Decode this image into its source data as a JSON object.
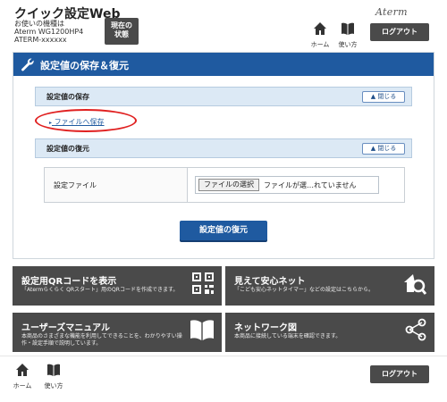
{
  "header": {
    "app_title": "クイック設定Web",
    "model_label": "お使いの機種は",
    "model_name": "Aterm WG1200HP4",
    "model_id": "ATERM-xxxxxx",
    "status_button_line1": "現在の",
    "status_button_line2": "状態",
    "home_label": "ホーム",
    "help_label": "使い方",
    "brand_logo": "Aterm",
    "logout_label": "ログアウト"
  },
  "main": {
    "title": "設定値の保存＆復元",
    "save_section": {
      "title": "設定値の保存",
      "close_label": "閉じる",
      "link_label": "ファイルへ保存"
    },
    "restore_section": {
      "title": "設定値の復元",
      "close_label": "閉じる",
      "file_label": "設定ファイル",
      "choose_button_label": "ファイルの選択",
      "file_status": "ファイルが選…れていません"
    },
    "restore_button_label": "設定値の復元"
  },
  "tiles": [
    {
      "title": "設定用QRコードを表示",
      "desc": "「Atermらくらく QRスタート」用のQRコードを作成できます。",
      "icon": "qr-code-icon"
    },
    {
      "title": "見えて安心ネット",
      "desc": "「こども安心ネットタイマー」などの設定はこちらから。",
      "icon": "house-search-icon"
    },
    {
      "title": "ユーザーズマニュアル",
      "desc": "本商品のさまざまな機能を利用してできることを、わかりやすい操作・設定手順で説明しています。",
      "icon": "book-icon"
    },
    {
      "title": "ネットワーク図",
      "desc": "本商品に接続している端末を確認できます。",
      "icon": "network-icon"
    }
  ],
  "footer": {
    "home_label": "ホーム",
    "help_label": "使い方",
    "logout_label": "ログアウト"
  },
  "colors": {
    "primary_blue": "#1f5aa0",
    "dark_gray": "#4a4a4a",
    "section_bg": "#dce9f5",
    "highlight_red": "#e02020"
  }
}
